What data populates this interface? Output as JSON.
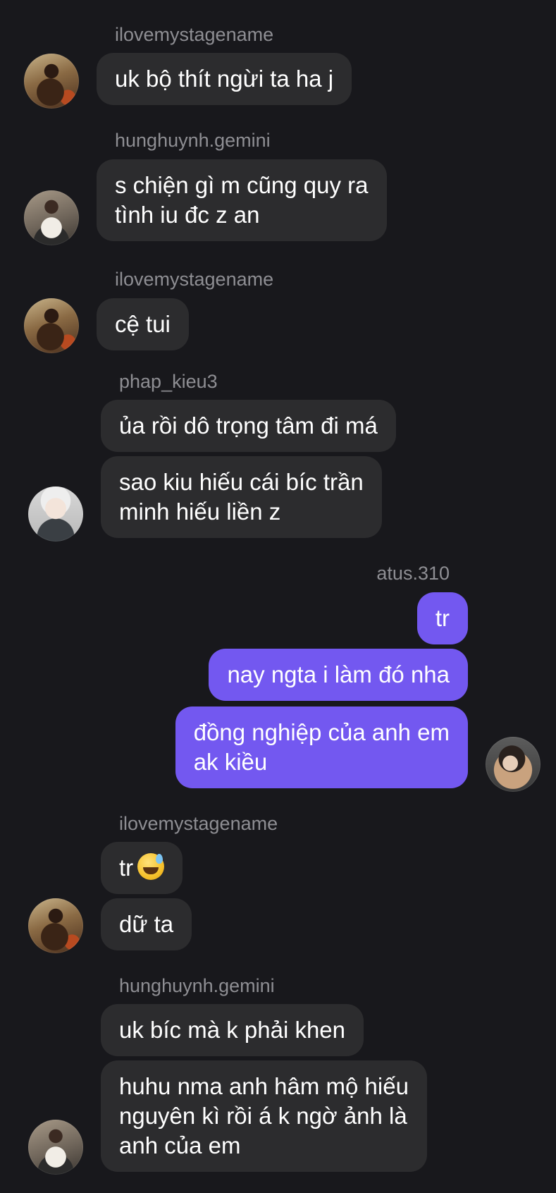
{
  "messages": [
    {
      "username": "ilovemystagename",
      "lines": [
        "uk bộ thít ngừi ta ha j"
      ]
    },
    {
      "username": "hunghuynh.gemini",
      "lines": [
        "s chiện gì m cũng quy ra",
        "tình iu đc z an"
      ]
    },
    {
      "username": "ilovemystagename",
      "lines": [
        "cệ tui"
      ]
    },
    {
      "username": "phap_kieu3",
      "bubbles": [
        {
          "lines": [
            "ủa rồi dô trọng tâm đi má"
          ]
        },
        {
          "lines": [
            "sao kiu hiếu cái bíc trần",
            "minh hiếu liền z"
          ]
        }
      ]
    },
    {
      "username": "atus.310",
      "mine": true,
      "bubbles": [
        {
          "lines": [
            "tr"
          ]
        },
        {
          "lines": [
            "nay ngta i làm đó nha"
          ]
        },
        {
          "lines": [
            "đồng nghiệp của anh em",
            "ak kiều"
          ]
        }
      ]
    },
    {
      "username": "ilovemystagename",
      "bubbles": [
        {
          "lines": [
            "tr"
          ],
          "emoji": "sweat-smile-emoji"
        },
        {
          "lines": [
            "dữ ta"
          ]
        }
      ]
    },
    {
      "username": "hunghuynh.gemini",
      "bubbles": [
        {
          "lines": [
            "uk bíc mà k phải khen"
          ]
        },
        {
          "lines": [
            "huhu nma anh hâm mộ hiếu",
            "nguyên kì rồi á k ngờ ảnh là",
            "anh của em"
          ]
        }
      ]
    }
  ],
  "colors": {
    "background": "#18181c",
    "incoming_bubble": "#2c2c2e",
    "outgoing_bubble": "#7358f0",
    "username": "#8e8e93",
    "text": "#ffffff"
  }
}
